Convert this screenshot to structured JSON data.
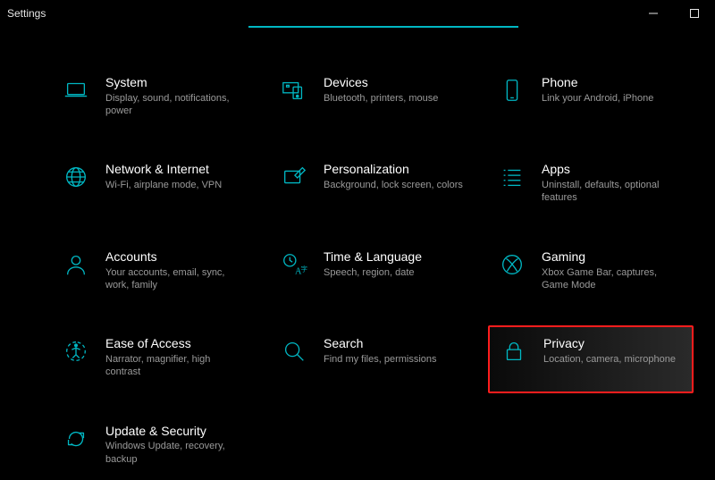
{
  "window": {
    "title": "Settings"
  },
  "colors": {
    "accent": "#00b7c3",
    "highlight_border": "#ff1d1d"
  },
  "categories": [
    {
      "id": "system",
      "icon": "laptop-icon",
      "title": "System",
      "desc": "Display, sound, notifications, power"
    },
    {
      "id": "devices",
      "icon": "devices-icon",
      "title": "Devices",
      "desc": "Bluetooth, printers, mouse"
    },
    {
      "id": "phone",
      "icon": "phone-icon",
      "title": "Phone",
      "desc": "Link your Android, iPhone"
    },
    {
      "id": "network",
      "icon": "globe-icon",
      "title": "Network & Internet",
      "desc": "Wi-Fi, airplane mode, VPN"
    },
    {
      "id": "personalization",
      "icon": "paint-icon",
      "title": "Personalization",
      "desc": "Background, lock screen, colors"
    },
    {
      "id": "apps",
      "icon": "apps-icon",
      "title": "Apps",
      "desc": "Uninstall, defaults, optional features"
    },
    {
      "id": "accounts",
      "icon": "person-icon",
      "title": "Accounts",
      "desc": "Your accounts, email, sync, work, family"
    },
    {
      "id": "time",
      "icon": "time-lang-icon",
      "title": "Time & Language",
      "desc": "Speech, region, date"
    },
    {
      "id": "gaming",
      "icon": "xbox-icon",
      "title": "Gaming",
      "desc": "Xbox Game Bar, captures, Game Mode"
    },
    {
      "id": "ease",
      "icon": "ease-icon",
      "title": "Ease of Access",
      "desc": "Narrator, magnifier, high contrast"
    },
    {
      "id": "search",
      "icon": "search-icon",
      "title": "Search",
      "desc": "Find my files, permissions"
    },
    {
      "id": "privacy",
      "icon": "lock-icon",
      "title": "Privacy",
      "desc": "Location, camera, microphone",
      "highlight": true
    },
    {
      "id": "update",
      "icon": "update-icon",
      "title": "Update & Security",
      "desc": "Windows Update, recovery, backup"
    }
  ]
}
